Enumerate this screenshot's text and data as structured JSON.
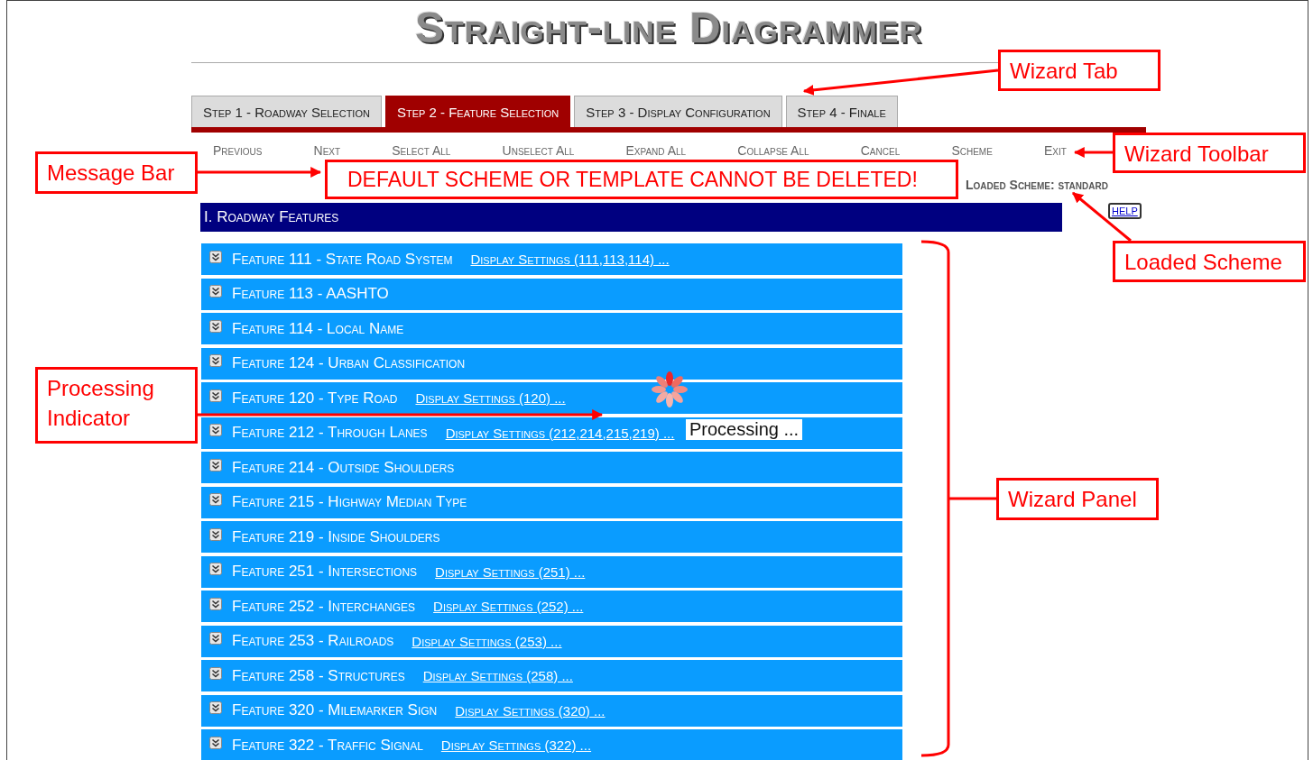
{
  "title": "Straight-line Diagrammer",
  "tabs": [
    {
      "label": "Step 1 - Roadway Selection",
      "selected": false
    },
    {
      "label": "Step 2 - Feature Selection",
      "selected": true
    },
    {
      "label": "Step 3 - Display Configuration",
      "selected": false
    },
    {
      "label": "Step 4 - Finale",
      "selected": false
    }
  ],
  "toolbar": [
    "Previous",
    "Next",
    "Select All",
    "Unselect All",
    "Expand All",
    "Collapse All",
    "Cancel",
    "Scheme",
    "Exit"
  ],
  "message_bar": {
    "text": "DEFAULT SCHEME OR TEMPLATE CANNOT BE DELETED!"
  },
  "loaded_scheme": "Loaded Scheme: standard",
  "section": {
    "title": "I. Roadway Features",
    "help": "HELP"
  },
  "features": [
    {
      "label": "Feature 111 - State Road System",
      "link": "Display Settings (111,113,114) ..."
    },
    {
      "label": "Feature 113 - AASHTO"
    },
    {
      "label": "Feature 114 - Local Name"
    },
    {
      "label": "Feature 124 - Urban Classification"
    },
    {
      "label": "Feature 120 - Type Road",
      "link": "Display Settings (120) ..."
    },
    {
      "label": "Feature 212 - Through Lanes",
      "link": "Display Settings (212,214,215,219) ..."
    },
    {
      "label": "Feature 214 - Outside Shoulders"
    },
    {
      "label": "Feature 215 - Highway Median Type"
    },
    {
      "label": "Feature 219 - Inside Shoulders"
    },
    {
      "label": "Feature 251 - Intersections",
      "link": "Display Settings (251) ..."
    },
    {
      "label": "Feature 252 - Interchanges",
      "link": "Display Settings (252) ..."
    },
    {
      "label": "Feature 253 - Railroads",
      "link": "Display Settings (253) ..."
    },
    {
      "label": "Feature 258 - Structures",
      "link": "Display Settings (258) ..."
    },
    {
      "label": "Feature 320 - Milemarker Sign",
      "link": "Display Settings (320) ..."
    },
    {
      "label": "Feature 322 - Traffic Signal",
      "link": "Display Settings (322) ..."
    }
  ],
  "processing": {
    "text": "Processing ..."
  },
  "annotations": [
    "Wizard Tab",
    "Wizard Toolbar",
    "Message Bar",
    "Loaded Scheme",
    "Processing Indicator",
    "Wizard Panel"
  ]
}
